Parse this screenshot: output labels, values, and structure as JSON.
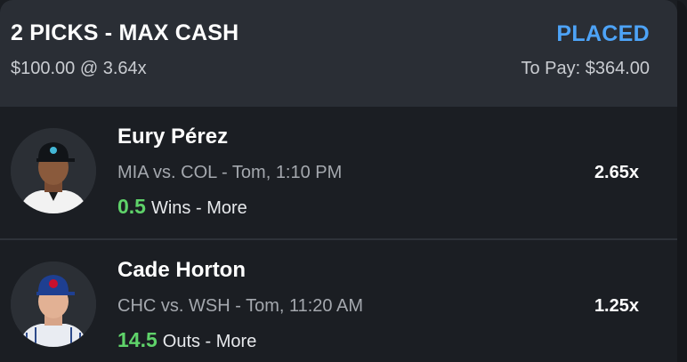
{
  "header": {
    "title": "2 PICKS - MAX CASH",
    "status": "PLACED",
    "stake": "$100.00 @ 3.64x",
    "to_pay": "To Pay: $364.00"
  },
  "picks": [
    {
      "player": "Eury Pérez",
      "matchup": "MIA vs. COL  - Tom, 1:10 PM",
      "line_value": "0.5",
      "line_stat": "Wins - More",
      "multiplier": "2.65x",
      "avatar_icon": "player-headshot-icon"
    },
    {
      "player": "Cade Horton",
      "matchup": "CHC vs. WSH  - Tom, 11:20 AM",
      "line_value": "14.5",
      "line_stat": "Outs - More",
      "multiplier": "1.25x",
      "avatar_icon": "player-headshot-icon"
    }
  ],
  "colors": {
    "status": "#4da3f7",
    "line_value": "#5fd36a",
    "header_bg": "#2a2e35",
    "body_bg": "#1b1e23"
  }
}
